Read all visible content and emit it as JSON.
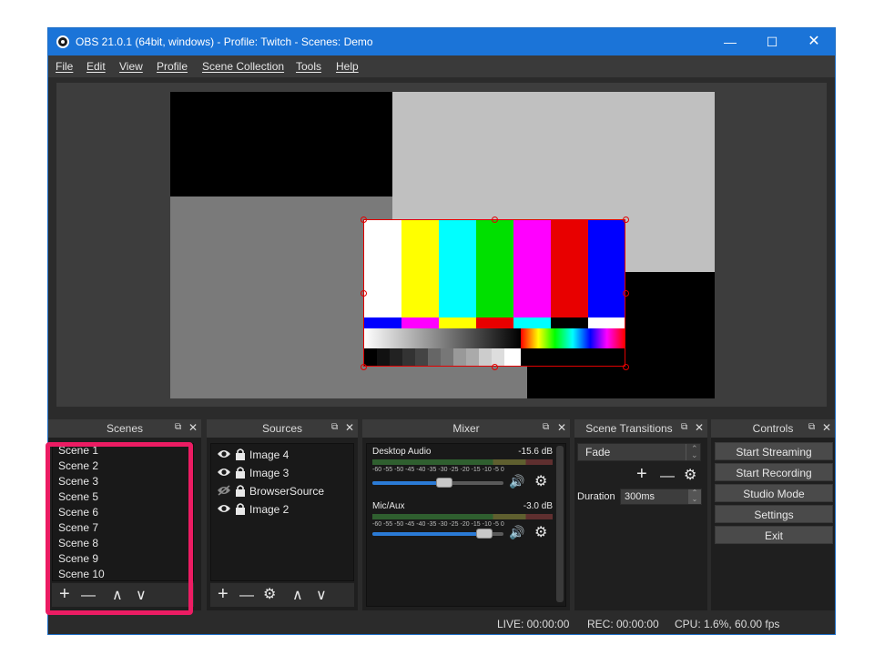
{
  "window": {
    "title": "OBS 21.0.1 (64bit, windows) - Profile: Twitch - Scenes: Demo",
    "controls": {
      "minimize": "—",
      "maximize": "☐",
      "close": "✕"
    }
  },
  "menu": [
    "File",
    "Edit",
    "View",
    "Profile",
    "Scene Collection",
    "Tools",
    "Help"
  ],
  "docks": {
    "scenes": {
      "title": "Scenes",
      "items": [
        "Scene 1",
        "Scene 2",
        "Scene 3",
        "Scene 5",
        "Scene 6",
        "Scene 7",
        "Scene 8",
        "Scene 9",
        "Scene 10"
      ],
      "toolbar": [
        "+",
        "—",
        "∧",
        "∨"
      ]
    },
    "sources": {
      "title": "Sources",
      "items": [
        "Image 4",
        "Image 3",
        "BrowserSource",
        "Image 2"
      ],
      "toolbar": [
        "+",
        "—",
        "⚙",
        "∧",
        "∨"
      ]
    },
    "mixer": {
      "title": "Mixer",
      "channels": [
        {
          "name": "Desktop Audio",
          "db": "-15.6 dB",
          "ticks": "-60 -55 -50 -45 -40 -35 -30 -25 -20 -15 -10 -5 0"
        },
        {
          "name": "Mic/Aux",
          "db": "-3.0 dB",
          "ticks": "-60 -55 -50 -45 -40 -35 -30 -25 -20 -15 -10 -5 0"
        }
      ],
      "volume_icon": "🔊",
      "gear_icon": "⚙"
    },
    "transitions": {
      "title": "Scene Transitions",
      "selected": "Fade",
      "duration_label": "Duration",
      "duration_value": "300ms",
      "toolbar": [
        "+",
        "—",
        "⚙"
      ]
    },
    "controls": {
      "title": "Controls",
      "buttons": [
        "Start Streaming",
        "Start Recording",
        "Studio Mode",
        "Settings",
        "Exit"
      ]
    }
  },
  "status": {
    "live": "LIVE: 00:00:00",
    "rec": "REC: 00:00:00",
    "cpu": "CPU: 1.6%, 60.00 fps"
  },
  "colors": {
    "bars_top": [
      "#ffffff",
      "#ffff00",
      "#00ffff",
      "#00e000",
      "#ff00ff",
      "#e80000",
      "#0000ff"
    ],
    "highlight": "#ec1c63",
    "titlebar": "#1b74d8"
  }
}
